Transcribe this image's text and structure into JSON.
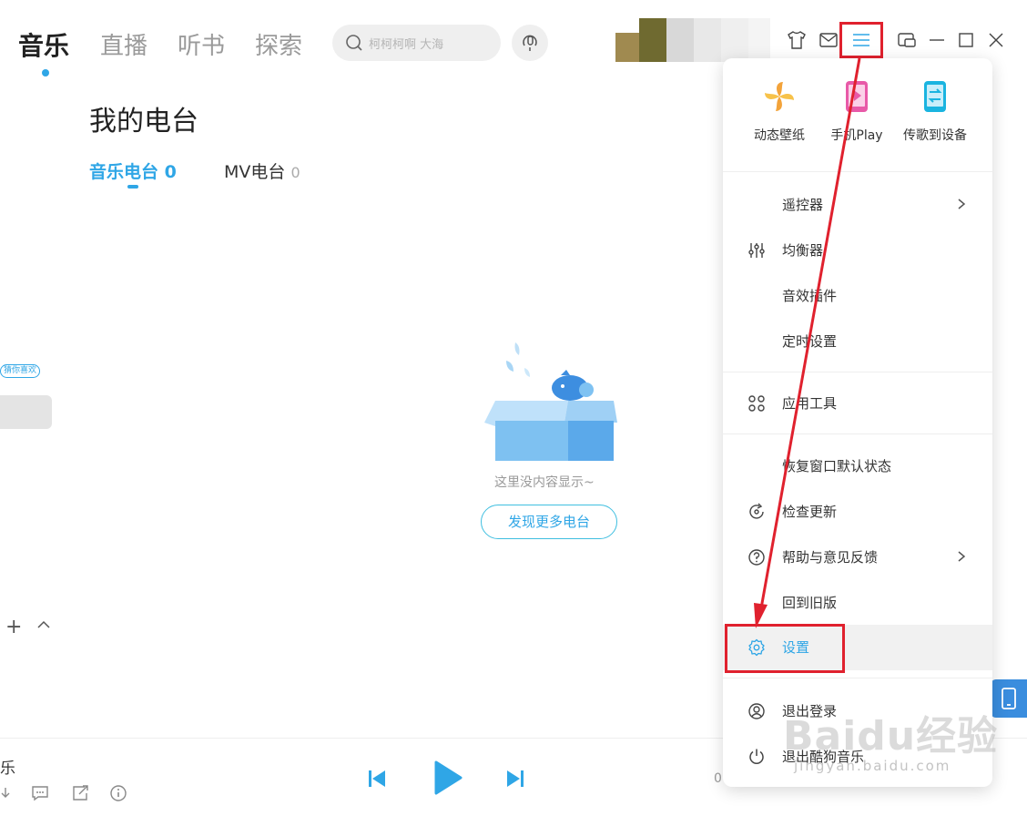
{
  "nav": {
    "tabs": [
      {
        "label": "音乐",
        "active": true
      },
      {
        "label": "直播",
        "active": false
      },
      {
        "label": "听书",
        "active": false
      },
      {
        "label": "探索",
        "active": false
      }
    ],
    "search_placeholder": "柯柯柯啊 大海",
    "icons": [
      "skin-icon",
      "mail-icon",
      "menu-icon",
      "mini-mode-icon",
      "minimize-icon",
      "maximize-icon",
      "close-icon"
    ]
  },
  "page": {
    "title": "我的电台",
    "tabs": [
      {
        "label": "音乐电台",
        "count": "0",
        "active": true
      },
      {
        "label": "MV电台",
        "count": "0",
        "active": false
      }
    ],
    "empty_text": "这里没内容显示~",
    "discover_button": "发现更多电台"
  },
  "left_panel": {
    "guess_tag": "猜你喜欢"
  },
  "player": {
    "song_fragment": "乐",
    "time": "0"
  },
  "menu": {
    "quick": [
      {
        "label": "动态壁纸",
        "icon": "pinwheel-icon"
      },
      {
        "label": "手机Play",
        "icon": "phone-play-icon"
      },
      {
        "label": "传歌到设备",
        "icon": "transfer-device-icon"
      }
    ],
    "items": [
      {
        "label": "遥控器",
        "icon": "",
        "submenu": true
      },
      {
        "label": "均衡器",
        "icon": "equalizer-icon",
        "submenu": false
      },
      {
        "label": "音效插件",
        "icon": "",
        "submenu": false
      },
      {
        "label": "定时设置",
        "icon": "",
        "submenu": false
      },
      {
        "label": "应用工具",
        "icon": "apps-icon",
        "submenu": false
      },
      {
        "label": "恢复窗口默认状态",
        "icon": "",
        "submenu": false
      },
      {
        "label": "检查更新",
        "icon": "update-icon",
        "submenu": false
      },
      {
        "label": "帮助与意见反馈",
        "icon": "help-icon",
        "submenu": true
      },
      {
        "label": "回到旧版",
        "icon": "",
        "submenu": false
      },
      {
        "label": "设置",
        "icon": "gear-icon",
        "submenu": false,
        "highlighted": true
      },
      {
        "label": "退出登录",
        "icon": "user-logout-icon",
        "submenu": false
      },
      {
        "label": "退出酷狗音乐",
        "icon": "power-icon",
        "submenu": false
      }
    ]
  },
  "watermark": {
    "brand": "Baidu经验",
    "url": "jingyan.baidu.com"
  },
  "colors": {
    "accent": "#2fa6e6",
    "annotation_red": "#e0212e"
  }
}
